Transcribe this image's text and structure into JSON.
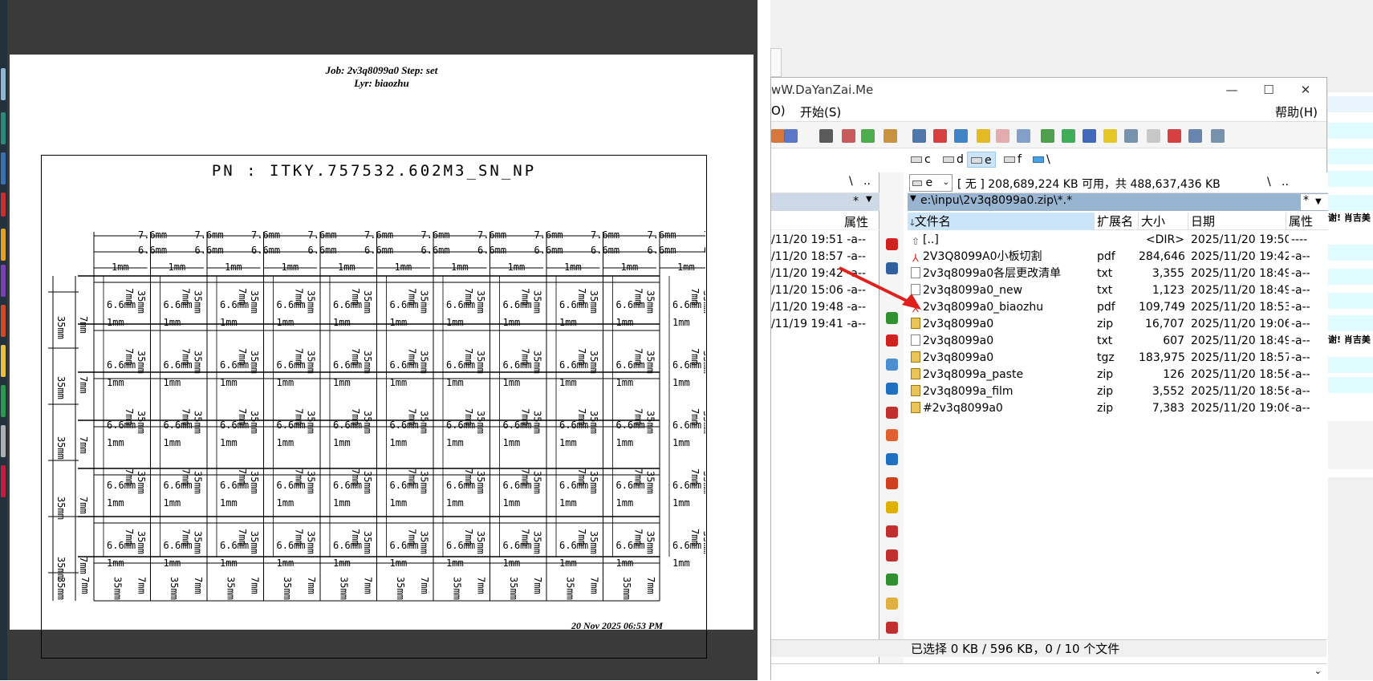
{
  "viewer": {
    "job_line": "Job: 2v3q8099a0  Step: set",
    "layer_line": "Lyr: biaozhu",
    "pn_label": "PN : ITKY.757532.602M3_SN_NP",
    "dim_76": "7.6mm",
    "dim_66": "6.6mm",
    "dim_1": "1mm",
    "dim_35": "35mm",
    "dim_7": "7mm",
    "footer_date": "20 Nov 2025 06:53 PM"
  },
  "window": {
    "title": "wW.DaYanZai.Me",
    "minimize_glyph": "—",
    "maximize_glyph": "☐",
    "close_glyph": "✕",
    "menu_left": "O)",
    "menu_start": "开始(S)",
    "menu_help": "帮助(H)",
    "drives": [
      "c",
      "d",
      "e",
      "f"
    ],
    "drive_backslash": "\\",
    "drive_select_value": "e",
    "free_space": "[ 无 ]  208,689,224 KB 可用，共 488,637,436 KB",
    "path": "e:\\inpu\\2v3q8099a0.zip\\*.*",
    "path_filter": "*",
    "left_header_attr": "属性",
    "left_nav_1": "\\",
    "left_nav_2": "..",
    "left_filter": "*",
    "right_nav_1": "\\",
    "right_nav_2": "..",
    "status": "已选择 0 KB / 596 KB，0 / 10 个文件"
  },
  "columns": {
    "name": "文件名",
    "ext": "扩展名",
    "size": "大小",
    "date": "日期",
    "attr": "属性"
  },
  "left_rows": [
    {
      "date": "/11/20 19:51",
      "attr": "-a--"
    },
    {
      "date": "/11/20 18:57",
      "attr": "-a--"
    },
    {
      "date": "/11/20 19:42",
      "attr": "-a--"
    },
    {
      "date": "/11/20 15:06",
      "attr": "-a--"
    },
    {
      "date": "/11/20 19:48",
      "attr": "-a--"
    },
    {
      "date": "/11/19 19:41",
      "attr": "-a--"
    }
  ],
  "files": [
    {
      "name": "[..]",
      "ext": "",
      "size": "<DIR>",
      "date": "2025/11/20 19:50",
      "attr": "----",
      "icon": "up-icon"
    },
    {
      "name": "2V3Q8099A0小板切割",
      "ext": "pdf",
      "size": "284,646",
      "date": "2025/11/20 19:42",
      "attr": "-a--",
      "icon": "pdf-icon"
    },
    {
      "name": "2v3q8099a0各层更改清单",
      "ext": "txt",
      "size": "3,355",
      "date": "2025/11/20 18:49",
      "attr": "-a--",
      "icon": "txt-icon"
    },
    {
      "name": "2v3q8099a0_new",
      "ext": "txt",
      "size": "1,123",
      "date": "2025/11/20 18:49",
      "attr": "-a--",
      "icon": "txt-icon"
    },
    {
      "name": "2v3q8099a0_biaozhu",
      "ext": "pdf",
      "size": "109,749",
      "date": "2025/11/20 18:53",
      "attr": "-a--",
      "icon": "pdf-icon"
    },
    {
      "name": "2v3q8099a0",
      "ext": "zip",
      "size": "16,707",
      "date": "2025/11/20 19:06",
      "attr": "-a--",
      "icon": "zip-icon"
    },
    {
      "name": "2v3q8099a0",
      "ext": "txt",
      "size": "607",
      "date": "2025/11/20 18:49",
      "attr": "-a--",
      "icon": "txt-icon"
    },
    {
      "name": "2v3q8099a0",
      "ext": "tgz",
      "size": "183,975",
      "date": "2025/11/20 18:57",
      "attr": "-a--",
      "icon": "zip-icon"
    },
    {
      "name": "2v3q8099a_paste",
      "ext": "zip",
      "size": "126",
      "date": "2025/11/20 18:56",
      "attr": "-a--",
      "icon": "zip-icon"
    },
    {
      "name": "2v3q8099a_film",
      "ext": "zip",
      "size": "3,552",
      "date": "2025/11/20 18:56",
      "attr": "-a--",
      "icon": "zip-icon"
    },
    {
      "name": "#2v3q8099a0",
      "ext": "zip",
      "size": "7,383",
      "date": "2025/11/20 19:06",
      "attr": "-a--",
      "icon": "zip-icon"
    }
  ],
  "background_window": {
    "snippet_1": "谢! 肖吉美",
    "snippet_2": "谢! 肖吉美"
  },
  "colors": {
    "viewer_bg": "#3a3a3a",
    "path_bar": "#99b4d1",
    "header_sort": "#cce4f7",
    "annotation_arrow": "#e0201a"
  }
}
